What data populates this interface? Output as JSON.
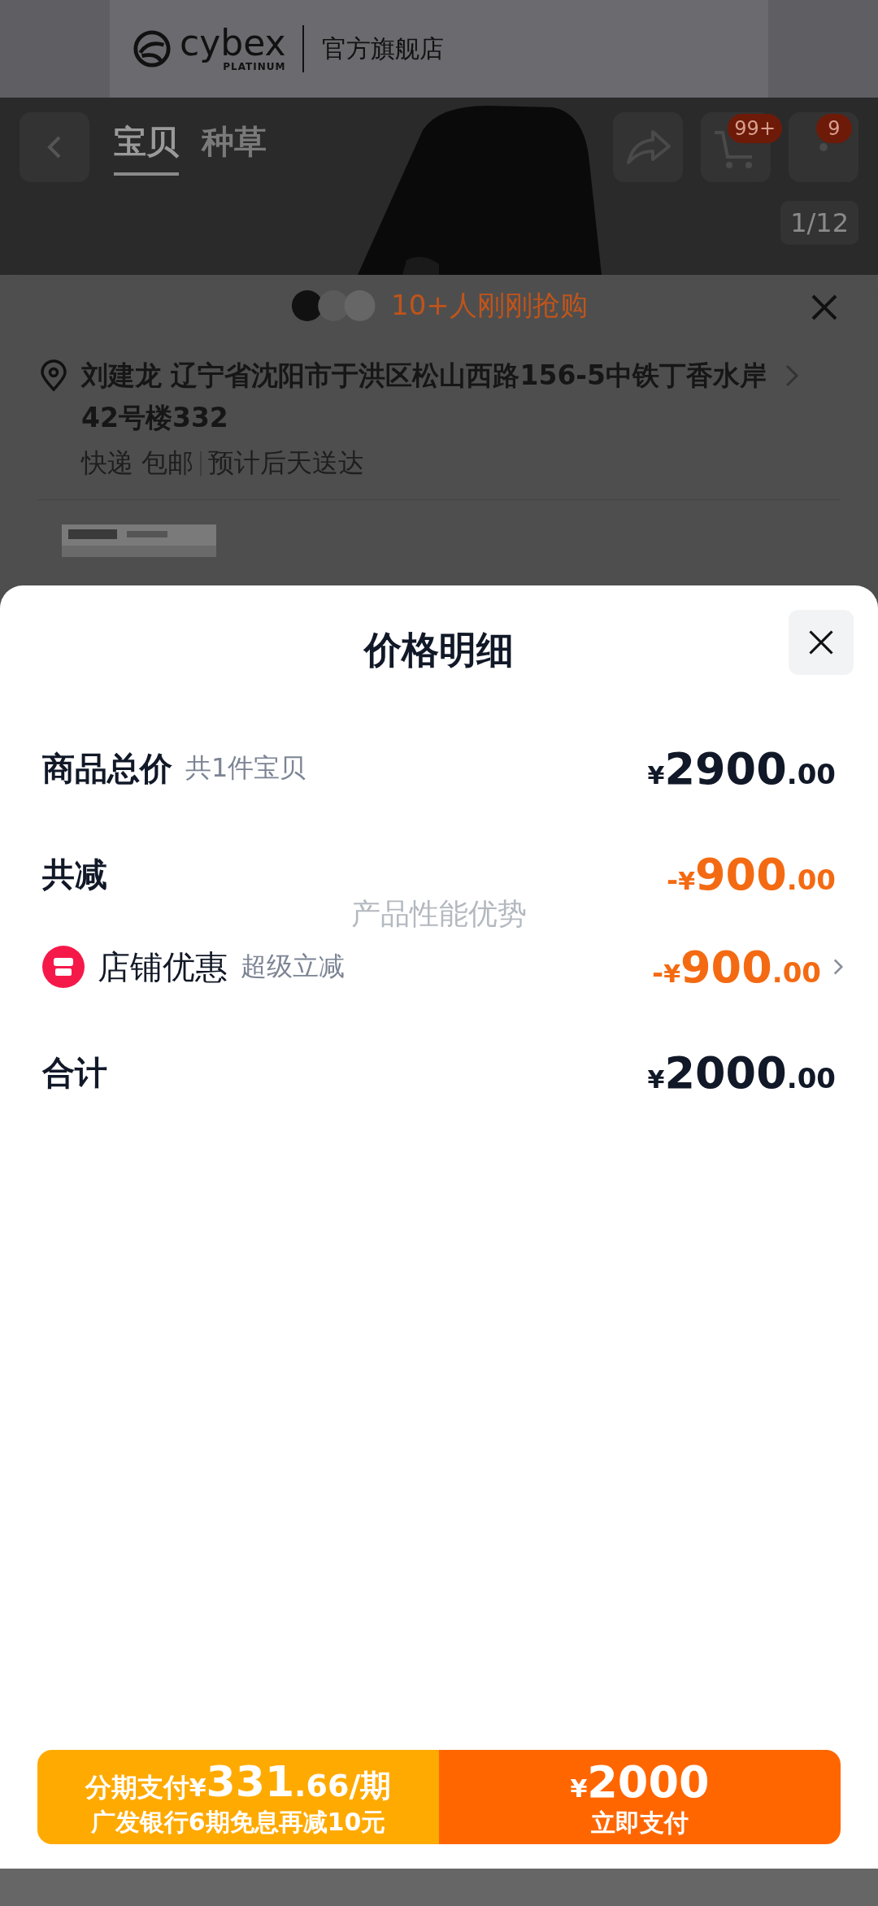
{
  "store_banner": {
    "logo_word": "cybex",
    "logo_sub": "PLATINUM",
    "store_name": "官方旗舰店"
  },
  "nav": {
    "tabs": [
      {
        "label": "宝贝",
        "selected": true
      },
      {
        "label": "种草",
        "selected": false
      }
    ],
    "cart_badge": "99+",
    "more_badge": "9",
    "image_counter": "1/12"
  },
  "order_sheet": {
    "buyers_text": "10+人刚刚抢购",
    "address": "刘建龙 辽宁省沈阳市于洪区松山西路156-5中铁丁香水岸42号楼332",
    "shipping": "快递 包邮",
    "delivery": "预计后天送达"
  },
  "price_sheet": {
    "title": "价格明细",
    "rows": [
      {
        "kind": "plain",
        "label": "商品总价",
        "note": "共1件宝贝",
        "sign": "",
        "currency": "¥",
        "amount": "2900",
        "decimals": ".00"
      },
      {
        "kind": "discount",
        "label": "共减",
        "sign": "-",
        "currency": "¥",
        "amount": "900",
        "decimals": ".00"
      },
      {
        "kind": "coupon",
        "label": "店铺优惠",
        "note": "超级立减",
        "sign": "-",
        "currency": "¥",
        "amount": "900",
        "decimals": ".00"
      },
      {
        "kind": "plain",
        "label": "合计",
        "sign": "",
        "currency": "¥",
        "amount": "2000",
        "decimals": ".00"
      }
    ],
    "overlay_text": "产品性能优势"
  },
  "pay_bar": {
    "installment": {
      "label": "分期支付",
      "currency": "¥",
      "amount": "331",
      "decimals": ".66",
      "unit": "/期",
      "promo": "广发银行6期免息再减10元"
    },
    "pay_now": {
      "currency": "¥",
      "amount": "2000",
      "label": "立即支付"
    }
  }
}
